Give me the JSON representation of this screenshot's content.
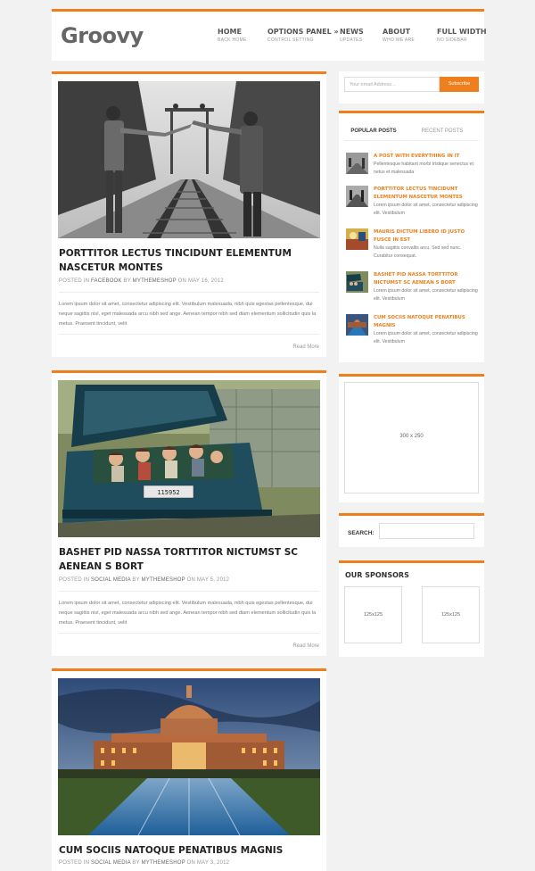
{
  "site": {
    "logo": "Groovy"
  },
  "nav": [
    {
      "label": "HOME",
      "sub": "BACK HOME"
    },
    {
      "label": "OPTIONS PANEL »",
      "sub": "CONTROL SETTING"
    },
    {
      "label": "NEWS",
      "sub": "UPDATES"
    },
    {
      "label": "ABOUT",
      "sub": "WHO WE ARE"
    },
    {
      "label": "FULL WIDTH",
      "sub": "NO SIDEBAR"
    }
  ],
  "posts": [
    {
      "title": "PORTTITOR LECTUS TINCIDUNT ELEMENTUM NASCETUR MONTES",
      "meta_prefix": "POSTED IN",
      "category": "FACEBOOK",
      "meta_by": "BY",
      "author": "MYTHEMESHOP",
      "meta_on": "ON",
      "date": "MAY 16, 2012",
      "excerpt": "Lorem ipsum dolor sit amet, consectetur adipiscing elit. Vestibulum malesuada, nibh quis egestas pellentesque, dui neque sagittis nisl, eget malesuada arcu nibh sed ange. Aenean tempor nibh sed diam elementum sollicitudin quis la metus. Praesent tincidunt, velit",
      "read_more": "Read More",
      "image_icon": "railway-couple-photo"
    },
    {
      "title": "BASHET PID NASSA TORTTITOR NICTUMST SC AENEAN S BORT",
      "meta_prefix": "POSTED IN",
      "category": "SOCIAL MEDIA",
      "meta_by": "BY",
      "author": "MYTHEMESHOP",
      "meta_on": "ON",
      "date": "MAY 5, 2012",
      "excerpt": "Lorem ipsum dolor sit amet, consectetur adipiscing elit. Vestibulum malesuada, nibh quis egestas pellentesque, dui neque sagittis nisl, eget malesuada arcu nibh sed ange. Aenean tempor nibh sed diam elementum sollicitudin quis la metus. Praesent tincidunt, velit",
      "read_more": "Read More",
      "image_icon": "car-trunk-kids-photo"
    },
    {
      "title": "CUM SOCIIS NATOQUE PENATIBUS MAGNIS",
      "meta_prefix": "POSTED IN",
      "category": "SOCIAL MEDIA",
      "meta_by": "BY",
      "author": "MYTHEMESHOP",
      "meta_on": "ON",
      "date": "MAY 3, 2012",
      "image_icon": "capitol-building-photo"
    }
  ],
  "subscribe": {
    "placeholder": "Your email Address...",
    "button": "Subscribe"
  },
  "tabs": {
    "popular": "POPULAR POSTS",
    "recent": "RECENT POSTS"
  },
  "popular_posts": [
    {
      "title": "A POST WITH EVERYTHING IN IT",
      "text": "Pellentesque habitant morbi tristique senectus et netus et malesuada"
    },
    {
      "title": "PORTTITOR LECTUS TINCIDUNT ELEMENTUM NASCETUR MONTES",
      "text": "Lorem ipsum dolor sit amet, consectetur adipiscing elit. Vestibulum"
    },
    {
      "title": "MAURIS DICTUM LIBERO ID JUSTO FUSCE IN EST",
      "text": "Nulla sagittis convallis arcu. Sed sed nunc. Curabitur consequat."
    },
    {
      "title": "BASHET PID NASSA TORTTITOR NICTUMST SC AENEAN S BORT",
      "text": "Lorem ipsum dolor sit amet, consectetur adipiscing elit. Vestibulum"
    },
    {
      "title": "CUM SOCIIS NATOQUE PENATIBUS MAGNIS",
      "text": "Lorem ipsum dolor sit amet, consectetur adipiscing elit. Vestibulum"
    }
  ],
  "ad": {
    "label": "300 x 250"
  },
  "search": {
    "label": "SEARCH:"
  },
  "sponsors": {
    "title": "OUR SPONSORS",
    "box1": "125x125",
    "box2": "125x125"
  },
  "colors": {
    "accent": "#ee7f1c",
    "background": "#f2f2f2",
    "card": "#ffffff"
  }
}
